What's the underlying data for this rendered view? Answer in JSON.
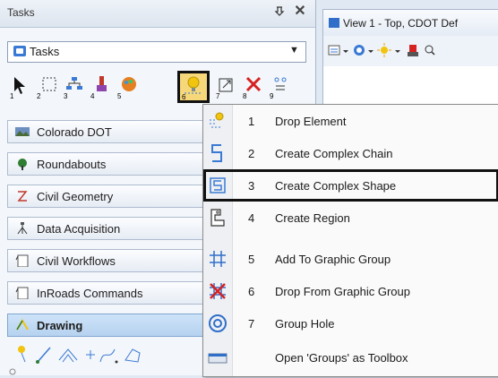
{
  "tasks_panel": {
    "title": "Tasks",
    "pin_glyph": "↕",
    "close_glyph": "✕",
    "dropdown": {
      "selected": "Tasks",
      "arrow": "▼"
    },
    "tools": [
      {
        "icon": "arrow-select-icon",
        "number": "1"
      },
      {
        "icon": "fence-icon",
        "number": "2"
      },
      {
        "icon": "tree-icon",
        "number": "3"
      },
      {
        "icon": "paintbrush-icon",
        "number": "4"
      },
      {
        "icon": "palette-icon",
        "number": "5"
      },
      {
        "icon": "drop-element-icon",
        "number": "6"
      },
      {
        "icon": "scale-icon",
        "number": "7"
      },
      {
        "icon": "delete-x-icon",
        "number": "8"
      },
      {
        "icon": "text-icon",
        "number": "9"
      }
    ],
    "categories": [
      {
        "label": "Colorado DOT",
        "icon": "colorado-dot-icon"
      },
      {
        "label": "Roundabouts",
        "icon": "roundabout-icon"
      },
      {
        "label": "Civil Geometry",
        "icon": "geometry-icon"
      },
      {
        "label": "Data Acquisition",
        "icon": "survey-icon"
      },
      {
        "label": "Civil Workflows",
        "icon": "workflow-icon"
      },
      {
        "label": "InRoads Commands",
        "icon": "inroads-icon"
      },
      {
        "label": "Drawing",
        "icon": "drawing-icon"
      }
    ]
  },
  "view": {
    "title": "View 1 - Top, CDOT Def"
  },
  "popup_menu": {
    "items": [
      {
        "number": "1",
        "label": "Drop Element",
        "icon": "drop-element-icon"
      },
      {
        "number": "2",
        "label": "Create Complex Chain",
        "icon": "complex-chain-icon"
      },
      {
        "number": "3",
        "label": "Create Complex Shape",
        "icon": "complex-shape-icon"
      },
      {
        "number": "4",
        "label": "Create Region",
        "icon": "region-icon"
      },
      {
        "number": "5",
        "label": "Add To Graphic Group",
        "icon": "graphic-group-icon"
      },
      {
        "number": "6",
        "label": "Drop From Graphic Group",
        "icon": "drop-graphic-group-icon"
      },
      {
        "number": "7",
        "label": "Group Hole",
        "icon": "group-hole-icon"
      },
      {
        "number": "",
        "label": "Open 'Groups' as Toolbox",
        "icon": "toolbox-icon"
      }
    ],
    "selected_index": 2
  },
  "colors": {
    "accent": "#2f6fc9",
    "highlight": "#111111"
  }
}
